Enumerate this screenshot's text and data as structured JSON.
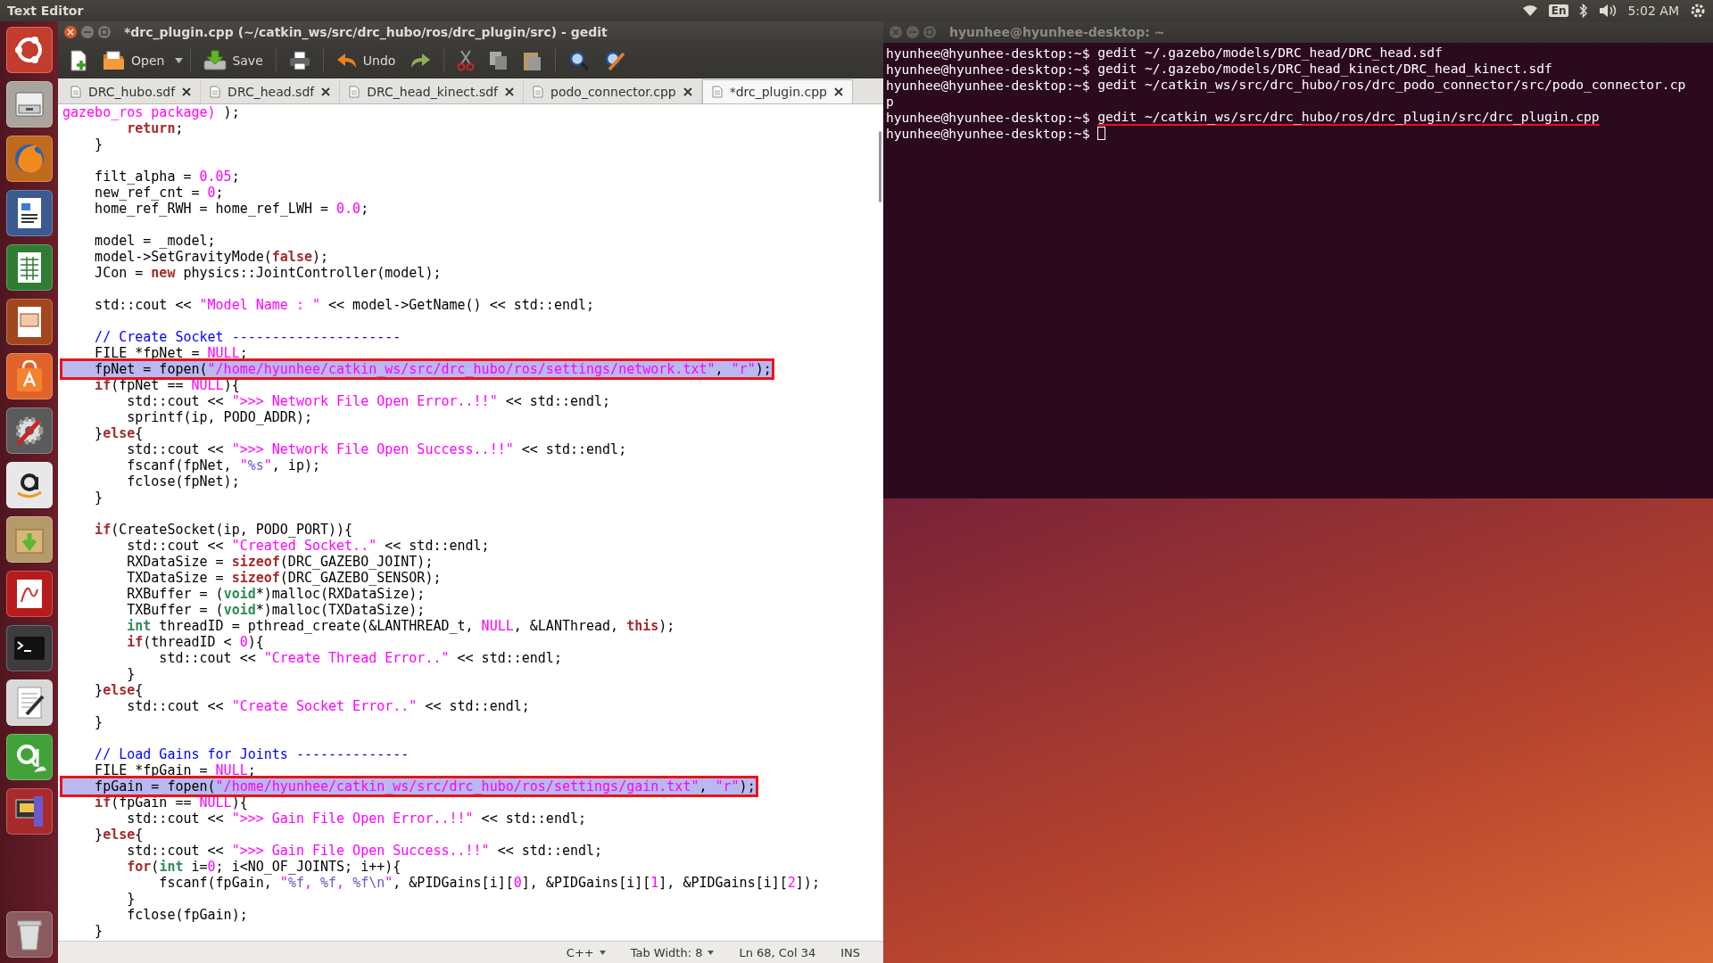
{
  "top_panel": {
    "app_title": "Text Editor",
    "keyboard": "En",
    "clock": "5:02 AM"
  },
  "editor": {
    "title": "*drc_plugin.cpp (~/catkin_ws/src/drc_hubo/ros/drc_plugin/src) - gedit",
    "toolbar": {
      "open": "Open",
      "save": "Save",
      "undo": "Undo"
    },
    "tabs": [
      {
        "label": "DRC_hubo.sdf",
        "selected": false
      },
      {
        "label": "DRC_head.sdf",
        "selected": false
      },
      {
        "label": "DRC_head_kinect.sdf",
        "selected": false
      },
      {
        "label": "podo_connector.cpp",
        "selected": false
      },
      {
        "label": "*drc_plugin.cpp",
        "selected": true
      }
    ],
    "lines": [
      {
        "kind": "code",
        "tokens": [
          {
            "kind": "string",
            "text": "gazebo_ros package)"
          },
          " );"
        ]
      },
      {
        "kind": "code",
        "tokens": [
          {
            "kind": "keyword",
            "text": "        return"
          },
          ";"
        ]
      },
      {
        "kind": "code",
        "tokens": [
          "    }"
        ]
      },
      {
        "kind": "blank"
      },
      {
        "kind": "code",
        "tokens": [
          "    filt_alpha = ",
          {
            "kind": "number",
            "text": "0.05"
          },
          ";"
        ]
      },
      {
        "kind": "code",
        "tokens": [
          "    new_ref_cnt = ",
          {
            "kind": "number",
            "text": "0"
          },
          ";"
        ]
      },
      {
        "kind": "code",
        "tokens": [
          "    home_ref_RWH = home_ref_LWH = ",
          {
            "kind": "number",
            "text": "0.0"
          },
          ";"
        ]
      },
      {
        "kind": "blank"
      },
      {
        "kind": "code",
        "tokens": [
          "    model = _model;"
        ]
      },
      {
        "kind": "code",
        "tokens": [
          "    model->SetGravityMode(",
          {
            "kind": "keyword",
            "text": "false"
          },
          ");"
        ]
      },
      {
        "kind": "code",
        "tokens": [
          "    JCon = ",
          {
            "kind": "keyword",
            "text": "new"
          },
          " physics::JointController(model);"
        ]
      },
      {
        "kind": "blank"
      },
      {
        "kind": "code",
        "tokens": [
          "    std::cout << ",
          {
            "kind": "string",
            "text": "\"Model Name : \""
          },
          " << model->GetName() << std::endl;"
        ]
      },
      {
        "kind": "blank"
      },
      {
        "kind": "code",
        "tokens": [
          {
            "kind": "comment",
            "text": "    // Create Socket ---------------------"
          }
        ]
      },
      {
        "kind": "code",
        "tokens": [
          "    FILE *fpNet = ",
          {
            "kind": "number",
            "text": "NULL"
          },
          ";"
        ]
      },
      {
        "kind": "marked",
        "tokens": [
          "    fpNet = fopen(",
          {
            "kind": "string",
            "text": "\"/home/hyunhee/catkin_ws/src/drc_hubo/ros/settings/network.txt\""
          },
          ", ",
          {
            "kind": "string",
            "text": "\"r\""
          },
          ");"
        ]
      },
      {
        "kind": "code",
        "tokens": [
          {
            "kind": "keyword",
            "text": "    if"
          },
          "(fpNet == ",
          {
            "kind": "number",
            "text": "NULL"
          },
          "){"
        ]
      },
      {
        "kind": "code",
        "tokens": [
          "        std::cout << ",
          {
            "kind": "string",
            "text": "\">>> Network File Open Error..!!\""
          },
          " << std::endl;"
        ]
      },
      {
        "kind": "code",
        "tokens": [
          "        sprintf(ip, PODO_ADDR);"
        ]
      },
      {
        "kind": "code",
        "tokens": [
          "    }",
          {
            "kind": "keyword",
            "text": "else"
          },
          "{"
        ]
      },
      {
        "kind": "code",
        "tokens": [
          "        std::cout << ",
          {
            "kind": "string",
            "text": "\">>> Network File Open Success..!!\""
          },
          " << std::endl;"
        ]
      },
      {
        "kind": "code",
        "tokens": [
          "        fscanf(fpNet, ",
          {
            "kind": "string",
            "text": "\""
          },
          {
            "kind": "escape",
            "text": "%s"
          },
          {
            "kind": "string",
            "text": "\""
          },
          ", ip);"
        ]
      },
      {
        "kind": "code",
        "tokens": [
          "        fclose(fpNet);"
        ]
      },
      {
        "kind": "code",
        "tokens": [
          "    }"
        ]
      },
      {
        "kind": "blank"
      },
      {
        "kind": "code",
        "tokens": [
          {
            "kind": "keyword",
            "text": "    if"
          },
          "(CreateSocket(ip, PODO_PORT)){"
        ]
      },
      {
        "kind": "code",
        "tokens": [
          "        std::cout << ",
          {
            "kind": "string",
            "text": "\"Created Socket..\""
          },
          " << std::endl;"
        ]
      },
      {
        "kind": "code",
        "tokens": [
          "        RXDataSize = ",
          {
            "kind": "keyword",
            "text": "sizeof"
          },
          "(DRC_GAZEBO_JOINT);"
        ]
      },
      {
        "kind": "code",
        "tokens": [
          "        TXDataSize = ",
          {
            "kind": "keyword",
            "text": "sizeof"
          },
          "(DRC_GAZEBO_SENSOR);"
        ]
      },
      {
        "kind": "code",
        "tokens": [
          "        RXBuffer = (",
          {
            "kind": "type",
            "text": "void"
          },
          "*)malloc(RXDataSize);"
        ]
      },
      {
        "kind": "code",
        "tokens": [
          "        TXBuffer = (",
          {
            "kind": "type",
            "text": "void"
          },
          "*)malloc(TXDataSize);"
        ]
      },
      {
        "kind": "code",
        "tokens": [
          {
            "kind": "type",
            "text": "        int"
          },
          " threadID = pthread_create(&LANTHREAD_t, ",
          {
            "kind": "number",
            "text": "NULL"
          },
          ", &LANThread, ",
          {
            "kind": "keyword",
            "text": "this"
          },
          ");"
        ]
      },
      {
        "kind": "code",
        "tokens": [
          {
            "kind": "keyword",
            "text": "        if"
          },
          "(threadID < ",
          {
            "kind": "number",
            "text": "0"
          },
          "){"
        ]
      },
      {
        "kind": "code",
        "tokens": [
          "            std::cout << ",
          {
            "kind": "string",
            "text": "\"Create Thread Error..\""
          },
          " << std::endl;"
        ]
      },
      {
        "kind": "code",
        "tokens": [
          "        }"
        ]
      },
      {
        "kind": "code",
        "tokens": [
          "    }",
          {
            "kind": "keyword",
            "text": "else"
          },
          "{"
        ]
      },
      {
        "kind": "code",
        "tokens": [
          "        std::cout << ",
          {
            "kind": "string",
            "text": "\"Create Socket Error..\""
          },
          " << std::endl;"
        ]
      },
      {
        "kind": "code",
        "tokens": [
          "    }"
        ]
      },
      {
        "kind": "blank"
      },
      {
        "kind": "code",
        "tokens": [
          {
            "kind": "comment",
            "text": "    // Load Gains for Joints --------------"
          }
        ]
      },
      {
        "kind": "code",
        "tokens": [
          "    FILE *fpGain = ",
          {
            "kind": "number",
            "text": "NULL"
          },
          ";"
        ]
      },
      {
        "kind": "marked",
        "tokens": [
          "    fpGain = fopen(",
          {
            "kind": "string",
            "text": "\"/home/hyunhee/catkin_ws/src/drc_hubo/ros/settings/gain.txt\""
          },
          ", ",
          {
            "kind": "string",
            "text": "\"r\""
          },
          ");"
        ]
      },
      {
        "kind": "code",
        "tokens": [
          {
            "kind": "keyword",
            "text": "    if"
          },
          "(fpGain == ",
          {
            "kind": "number",
            "text": "NULL"
          },
          "){"
        ]
      },
      {
        "kind": "code",
        "tokens": [
          "        std::cout << ",
          {
            "kind": "string",
            "text": "\">>> Gain File Open Error..!!\""
          },
          " << std::endl;"
        ]
      },
      {
        "kind": "code",
        "tokens": [
          "    }",
          {
            "kind": "keyword",
            "text": "else"
          },
          "{"
        ]
      },
      {
        "kind": "code",
        "tokens": [
          "        std::cout << ",
          {
            "kind": "string",
            "text": "\">>> Gain File Open Success..!!\""
          },
          " << std::endl;"
        ]
      },
      {
        "kind": "code",
        "tokens": [
          {
            "kind": "keyword",
            "text": "        for"
          },
          "(",
          {
            "kind": "type",
            "text": "int"
          },
          " i=",
          {
            "kind": "number",
            "text": "0"
          },
          "; i<NO_OF_JOINTS; i++){"
        ]
      },
      {
        "kind": "code",
        "tokens": [
          "            fscanf(fpGain, ",
          {
            "kind": "string",
            "text": "\""
          },
          {
            "kind": "escape",
            "text": "%f"
          },
          {
            "kind": "string",
            "text": ", "
          },
          {
            "kind": "escape",
            "text": "%f"
          },
          {
            "kind": "string",
            "text": ", "
          },
          {
            "kind": "escape",
            "text": "%f\\n"
          },
          {
            "kind": "string",
            "text": "\""
          },
          ", &PIDGains[i][",
          {
            "kind": "number",
            "text": "0"
          },
          "], &PIDGains[i][",
          {
            "kind": "number",
            "text": "1"
          },
          "], &PIDGains[i][",
          {
            "kind": "number",
            "text": "2"
          },
          "]);"
        ]
      },
      {
        "kind": "code",
        "tokens": [
          "        }"
        ]
      },
      {
        "kind": "code",
        "tokens": [
          "        fclose(fpGain);"
        ]
      },
      {
        "kind": "code",
        "tokens": [
          "    }"
        ]
      }
    ],
    "status_bar": {
      "language": "C++",
      "tab_width": "Tab Width: 8",
      "position": "Ln 68, Col 34",
      "mode": "INS"
    }
  },
  "terminal": {
    "title": "hyunhee@hyunhee-desktop: ~",
    "lines": [
      {
        "kind": "command",
        "prompt": "hyunhee@hyunhee-desktop:~$",
        "command": "gedit ~/.gazebo/models/DRC_head/DRC_head.sdf",
        "underlined": false,
        "cursor": false
      },
      {
        "kind": "command",
        "prompt": "hyunhee@hyunhee-desktop:~$",
        "command": "gedit ~/.gazebo/models/DRC_head_kinect/DRC_head_kinect.sdf",
        "underlined": false,
        "cursor": false
      },
      {
        "kind": "command",
        "prompt": "hyunhee@hyunhee-desktop:~$",
        "command": "gedit ~/catkin_ws/src/drc_hubo/ros/drc_podo_connector/src/podo_connector.cp",
        "underlined": false,
        "cursor": false
      },
      {
        "kind": "output",
        "text": "p"
      },
      {
        "kind": "command",
        "prompt": "hyunhee@hyunhee-desktop:~$",
        "command": "gedit ~/catkin_ws/src/drc_hubo/ros/drc_plugin/src/drc_plugin.cpp",
        "underlined": true,
        "cursor": false
      },
      {
        "kind": "command",
        "prompt": "hyunhee@hyunhee-desktop:~$",
        "cursor": true
      }
    ]
  }
}
